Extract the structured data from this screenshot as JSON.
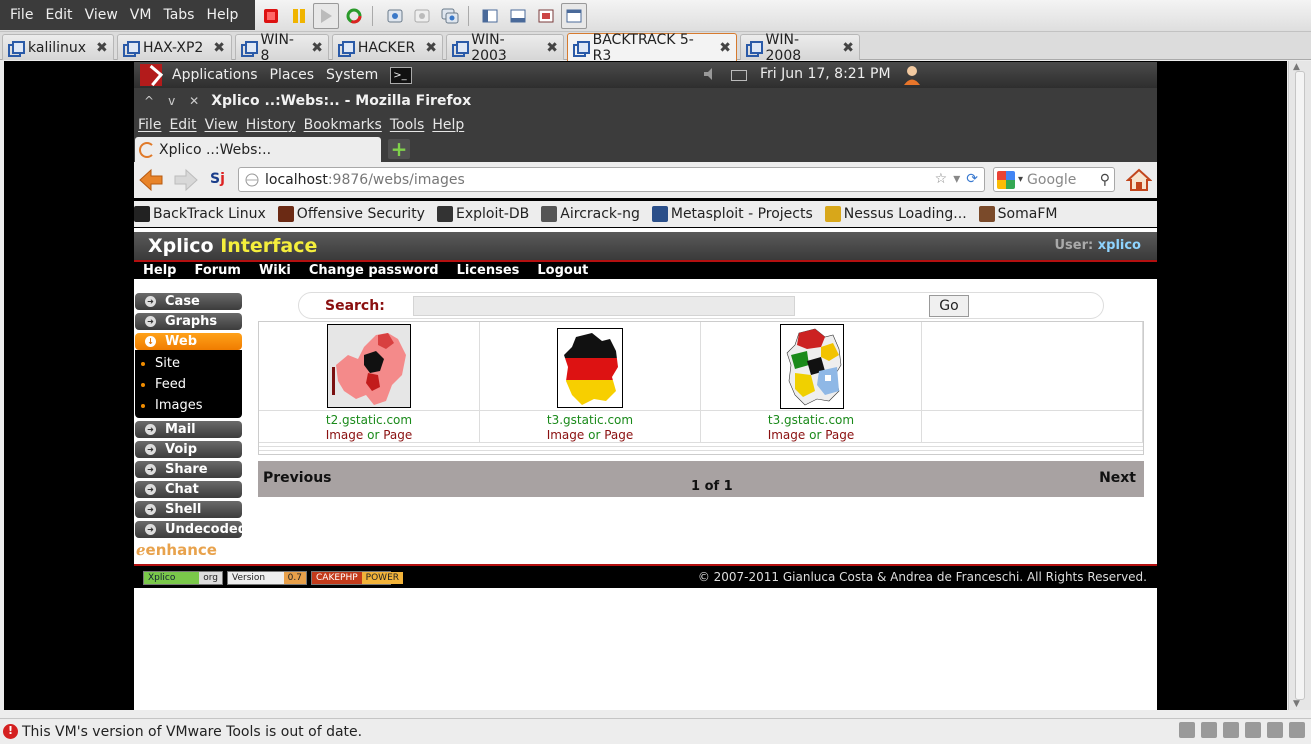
{
  "host": {
    "menus": [
      "File",
      "Edit",
      "View",
      "VM",
      "Tabs",
      "Help"
    ],
    "tabs": [
      {
        "label": "kalilinux"
      },
      {
        "label": "HAX-XP2"
      },
      {
        "label": "WIN-8"
      },
      {
        "label": "HACKER"
      },
      {
        "label": "WIN-2003"
      },
      {
        "label": "BACKTRACK 5-R3",
        "active": true
      },
      {
        "label": "WIN-2008"
      }
    ],
    "close_glyph": "✖",
    "status_text": "This VM's version of VMware Tools is out of date.",
    "toolbar_icons": [
      "power-off-icon",
      "pause-icon",
      "play-icon",
      "reset-icon",
      "snapshot-icon",
      "revert-icon",
      "snapshot-manager-icon",
      "quick-switch-icon",
      "fullscreen-icon",
      "unity-icon",
      "console-view-icon"
    ]
  },
  "gnome": {
    "menus": [
      "Applications",
      "Places",
      "System"
    ],
    "clock": "Fri Jun 17,  8:21 PM"
  },
  "firefox": {
    "window_title": "Xplico ..:Webs:.. - Mozilla Firefox",
    "menus": [
      "File",
      "Edit",
      "View",
      "History",
      "Bookmarks",
      "Tools",
      "Help"
    ],
    "tab_title": "Xplico ..:Webs:..",
    "new_tab": "+",
    "url_host": "localhost",
    "url_path": ":9876/webs/images",
    "search_placeholder": "Google",
    "bookmarks": [
      {
        "label": "BackTrack Linux",
        "color": "#222222"
      },
      {
        "label": "Offensive Security",
        "color": "#6b2a14"
      },
      {
        "label": "Exploit-DB",
        "color": "#333333"
      },
      {
        "label": "Aircrack-ng",
        "color": "#555555"
      },
      {
        "label": "Metasploit - Projects",
        "color": "#2b4f8a"
      },
      {
        "label": "Nessus Loading...",
        "color": "#d8a71a"
      },
      {
        "label": "SomaFM",
        "color": "#7a4a2a"
      }
    ]
  },
  "xplico": {
    "logo_main": "Xplico",
    "logo_accent": "Interface",
    "user_label": "User:",
    "user_name": "xplico",
    "nav": [
      "Help",
      "Forum",
      "Wiki",
      "Change password",
      "Licenses",
      "Logout"
    ],
    "sidebar_top": [
      {
        "label": "Case"
      },
      {
        "label": "Graphs"
      },
      {
        "label": "Web",
        "active": true
      }
    ],
    "web_sub": [
      "Site",
      "Feed",
      "Images"
    ],
    "sidebar_bottom": [
      {
        "label": "Mail"
      },
      {
        "label": "Voip"
      },
      {
        "label": "Share"
      },
      {
        "label": "Chat"
      },
      {
        "label": "Shell"
      },
      {
        "label": "Undecoded"
      }
    ],
    "enhance": "enhance",
    "search_label": "Search:",
    "search_value": "",
    "go_label": "Go",
    "images": [
      {
        "host": "t2.gstatic.com",
        "image": "Image",
        "or": "or",
        "page": "Page",
        "thumb": "europe-map-thumbnail"
      },
      {
        "host": "t3.gstatic.com",
        "image": "Image",
        "or": "or",
        "page": "Page",
        "thumb": "germany-flag-map-thumbnail"
      },
      {
        "host": "t3.gstatic.com",
        "image": "Image",
        "or": "or",
        "page": "Page",
        "thumb": "germany-states-map-thumbnail"
      }
    ],
    "previous": "Previous",
    "next": "Next",
    "page_count": "1 of 1",
    "footer_badges": [
      {
        "a": "Xplico",
        "b": "org"
      },
      {
        "a": "Version",
        "b": "0.7"
      },
      {
        "a": "CAKEPHP",
        "b": "POWER"
      }
    ],
    "copyright": "© 2007-2011 Gianluca Costa & Andrea de Franceschi. All Rights Reserved.",
    "colors": {
      "accent_orange": "#f07c00",
      "header_red": "#b41010",
      "logo_yellow": "#f4ee3c",
      "link_green": "#1a8a1a"
    }
  }
}
